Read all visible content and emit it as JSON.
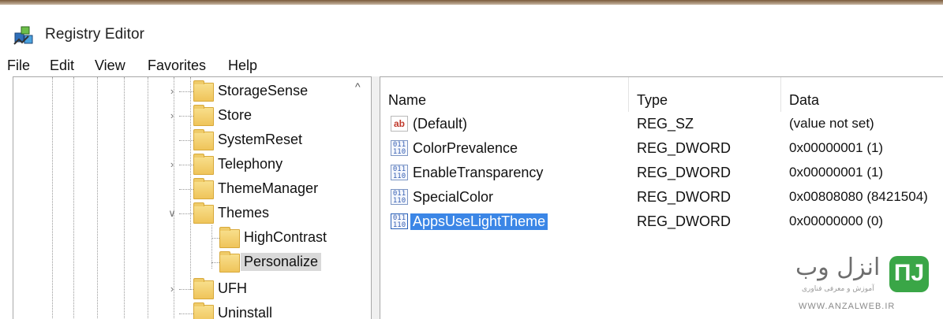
{
  "window": {
    "title": "Registry Editor"
  },
  "menu": [
    "File",
    "Edit",
    "View",
    "Favorites",
    "Help"
  ],
  "tree": {
    "items": [
      {
        "label": "StorageSense",
        "expander": "chevron-right",
        "level": 0
      },
      {
        "label": "Store",
        "expander": "chevron-right",
        "level": 0
      },
      {
        "label": "SystemReset",
        "expander": "none",
        "level": 0
      },
      {
        "label": "Telephony",
        "expander": "chevron-right",
        "level": 0
      },
      {
        "label": "ThemeManager",
        "expander": "none",
        "level": 0
      },
      {
        "label": "Themes",
        "expander": "chevron-down",
        "level": 0
      },
      {
        "label": "HighContrast",
        "expander": "none",
        "level": 1
      },
      {
        "label": "Personalize",
        "expander": "none",
        "level": 1,
        "selected": true
      },
      {
        "label": "UFH",
        "expander": "chevron-right",
        "level": 0
      },
      {
        "label": "Uninstall",
        "expander": "none",
        "level": 0
      }
    ],
    "scroll_up_glyph": "^"
  },
  "list": {
    "columns": [
      "Name",
      "Type",
      "Data"
    ],
    "rows": [
      {
        "icon": "string-value-icon",
        "icon_text": "ab",
        "name": "(Default)",
        "type": "REG_SZ",
        "data": "(value not set)"
      },
      {
        "icon": "binary-value-icon",
        "icon_text": "011\n110",
        "name": "ColorPrevalence",
        "type": "REG_DWORD",
        "data": "0x00000001 (1)"
      },
      {
        "icon": "binary-value-icon",
        "icon_text": "011\n110",
        "name": "EnableTransparency",
        "type": "REG_DWORD",
        "data": "0x00000001 (1)"
      },
      {
        "icon": "binary-value-icon",
        "icon_text": "011\n110",
        "name": "SpecialColor",
        "type": "REG_DWORD",
        "data": "0x00808080 (8421504)"
      },
      {
        "icon": "binary-value-icon",
        "icon_text": "011\n110",
        "name": "AppsUseLightTheme",
        "type": "REG_DWORD",
        "data": "0x00000000 (0)",
        "selected": true
      }
    ]
  },
  "watermark": {
    "logo": "ПЈ",
    "title": "انزل وب",
    "subtitle": "آموزش و معرفی فناوری",
    "url": "WWW.ANZALWEB.IR"
  },
  "colors": {
    "selection": "#3b86e6",
    "folder": "#efc45a",
    "watermark_green": "#3aa647"
  }
}
